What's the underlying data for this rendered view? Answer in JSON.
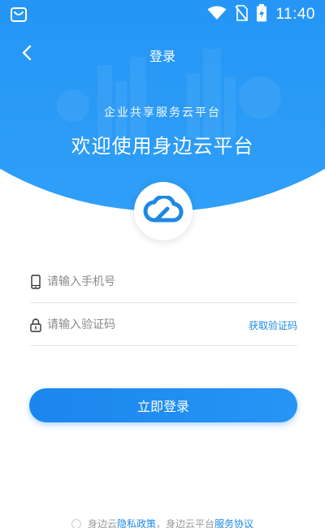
{
  "status_bar": {
    "time": "11:40",
    "icons": [
      "shopping-bag-icon",
      "wifi-icon",
      "no-sim-icon",
      "battery-charging-icon"
    ]
  },
  "nav": {
    "title": "登录",
    "back_icon": "chevron-left-icon"
  },
  "hero": {
    "subtitle": "企业共享服务云平台",
    "title": "欢迎使用身边云平台",
    "logo_icon": "cloud-icon"
  },
  "form": {
    "phone": {
      "placeholder": "请输入手机号",
      "value": "",
      "icon": "phone-icon"
    },
    "code": {
      "placeholder": "请输入验证码",
      "value": "",
      "icon": "lock-icon",
      "get_code_label": "获取验证码"
    },
    "login_label": "立即登录"
  },
  "agreement": {
    "text1": "身边云",
    "privacy_label": "隐私政策",
    "text2": "，身边云平台",
    "service_label": "服务协议"
  },
  "colors": {
    "primary": "#2196f3",
    "link": "#1e88e5",
    "hint": "#8a8a8a"
  }
}
